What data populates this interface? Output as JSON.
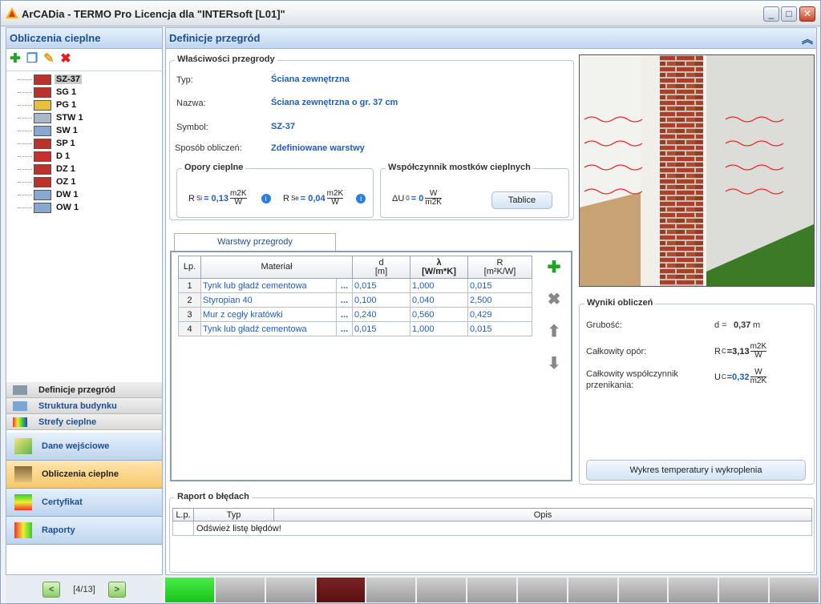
{
  "window": {
    "title": "ArCADia - TERMO Pro Licencja dla \"INTERsoft [L01]\""
  },
  "left": {
    "header": "Obliczenia cieplne",
    "tree": [
      {
        "label": "SZ-37",
        "selected": true
      },
      {
        "label": "SG 1"
      },
      {
        "label": "PG 1"
      },
      {
        "label": "STW 1"
      },
      {
        "label": "SW 1"
      },
      {
        "label": "SP 1"
      },
      {
        "label": "D 1"
      },
      {
        "label": "DZ 1"
      },
      {
        "label": "OZ 1"
      },
      {
        "label": "DW 1"
      },
      {
        "label": "OW 1"
      }
    ],
    "subnav": [
      "Definicje przegród",
      "Struktura budynku",
      "Strefy cieplne"
    ],
    "nav": [
      "Dane wejściowe",
      "Obliczenia cieplne",
      "Certyfikat",
      "Raporty"
    ],
    "pager": "[4/13]"
  },
  "right": {
    "header": "Definicje przegród",
    "props": {
      "title": "Właściwości przegrody",
      "typ_label": "Typ:",
      "typ": "Ściana zewnętrzna",
      "nazwa_label": "Nazwa:",
      "nazwa": "Ściana zewnętrzna o gr. 37 cm",
      "symbol_label": "Symbol:",
      "symbol": "SZ-37",
      "sposob_label": "Sposób obliczeń:",
      "sposob": "Zdefiniowane warstwy"
    },
    "opory": {
      "title": "Opory cieplne",
      "rsi_label": "R",
      "rsi_sub": "Si",
      "rsi": "= 0,13",
      "rse_label": "R",
      "rse_sub": "Se",
      "rse": "= 0,04",
      "unit_top": "m2K",
      "unit_bot": "W"
    },
    "mostki": {
      "title": "Współczynnik mostków cieplnych",
      "du_label": "ΔU",
      "du_sub": "0",
      "du": "= 0",
      "unit_top": "W",
      "unit_bot": "m2K",
      "button": "Tablice"
    },
    "layers": {
      "tab": "Warstwy przegrody",
      "headers": {
        "lp": "Lp.",
        "material": "Materiał",
        "d": "d",
        "d_unit": "[m]",
        "lambda": "λ",
        "lambda_unit": "[W/m*K]",
        "r": "R",
        "r_unit": "[m²K/W]"
      },
      "rows": [
        {
          "n": "1",
          "material": "Tynk lub gładź cementowa",
          "dots": "...",
          "d": "0,015",
          "lambda": "1,000",
          "r": "0,015"
        },
        {
          "n": "2",
          "material": "Styropian 40",
          "dots": "...",
          "d": "0,100",
          "lambda": "0,040",
          "r": "2,500"
        },
        {
          "n": "3",
          "material": "Mur z cegły kratówki",
          "dots": "...",
          "d": "0,240",
          "lambda": "0,560",
          "r": "0,429"
        },
        {
          "n": "4",
          "material": "Tynk lub gładź cementowa",
          "dots": "...",
          "d": "0,015",
          "lambda": "1,000",
          "r": "0,015"
        }
      ]
    },
    "results": {
      "title": "Wyniki obliczeń",
      "grubosc_label": "Grubość:",
      "d_label": "d =",
      "d": "0,37",
      "d_unit": "m",
      "opor_label": "Całkowity opór:",
      "rc_label": "R",
      "rc_sub": "C",
      "rc": "=3,13",
      "rc_unit_top": "m2K",
      "rc_unit_bot": "W",
      "wsp_label": "Całkowity współczynnik przenikania:",
      "uc_label": "U",
      "uc_sub": "C",
      "uc": "=0,32",
      "uc_unit_top": "W",
      "uc_unit_bot": "m2K",
      "button": "Wykres temperatury i wykroplenia"
    },
    "report": {
      "title": "Raport o błędach",
      "headers": [
        "L.p.",
        "Typ",
        "Opis"
      ],
      "rows": [
        {
          "lp": "",
          "typ": "Odśwież listę błędów!",
          "opis": ""
        }
      ]
    }
  },
  "progress": {
    "segments": 13,
    "done": 1,
    "current": 4
  },
  "colors": {
    "accent": "#1f5dbc",
    "header": "#1d4f8f",
    "done": "#18c418",
    "current": "#5b1010"
  }
}
